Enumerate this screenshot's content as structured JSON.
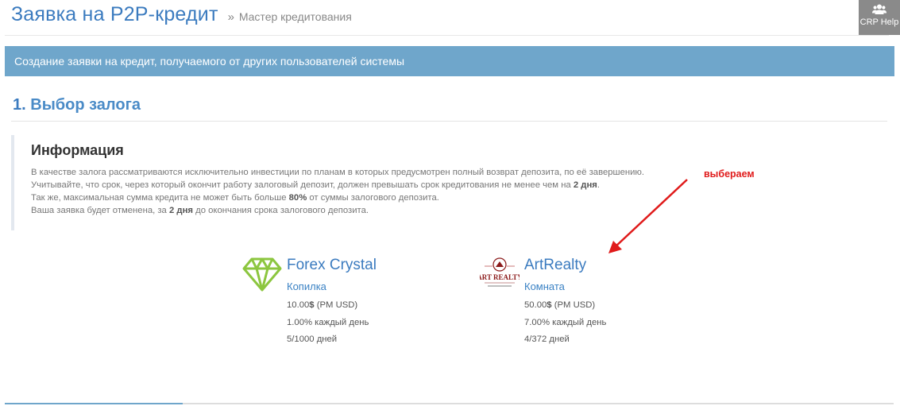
{
  "header": {
    "title": "Заявка на P2P-кредит",
    "subtitle_separator": "»",
    "subtitle": "Мастер кредитования"
  },
  "help": {
    "label": "CRP Help",
    "icon": "users-icon"
  },
  "banner": {
    "text": "Создание заявки на кредит, получаемого от других пользователей системы"
  },
  "step": {
    "number": "1.",
    "title": "Выбор залога"
  },
  "info": {
    "heading": "Информация",
    "line1": "В качестве залога рассматриваются исключительно инвестиции по планам в которых предусмотрен полный возврат депозита, по её завершению.",
    "line2_pre": "Учитывайте, что срок, через который окончит работу залоговый депозит, должен превышать срок кредитования не менее чем на ",
    "line2_bold": "2 дня",
    "line2_post": ".",
    "line3_pre": "Так же, максимальная сумма кредита не может быть больше ",
    "line3_bold": "80%",
    "line3_post": " от суммы залогового депозита.",
    "line4_pre": "Ваша заявка будет отменена, за ",
    "line4_bold": "2 дня",
    "line4_post": " до окончания срока залогового депозита."
  },
  "annotation": {
    "text": "выбераем",
    "color": "#e01a1a"
  },
  "plans": [
    {
      "name": "Forex Crystal",
      "type": "Копилка",
      "amount": "10.00",
      "currency_symbol": "$",
      "currency_note": " (PM USD)",
      "rate": "1.00% каждый день",
      "days": "5/1000 дней",
      "logo": "diamond-icon",
      "logo_color": "#8cc63f"
    },
    {
      "name": "ArtRealty",
      "type": "Комната",
      "amount": "50.00",
      "currency_symbol": "$",
      "currency_note": " (PM USD)",
      "rate": "7.00% каждый день",
      "days": "4/372 дней",
      "logo": "art-realty-logo",
      "logo_text": "ART REALTY",
      "logo_color": "#8b1a1a"
    }
  ],
  "colors": {
    "accent": "#3b7bbf",
    "banner": "#6fa6cb"
  }
}
